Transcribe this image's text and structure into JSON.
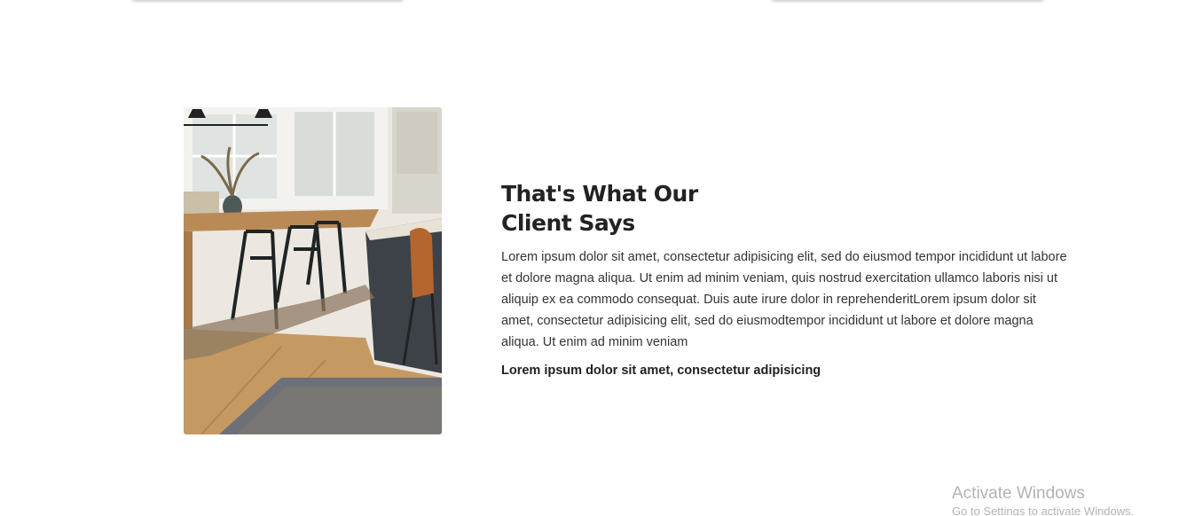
{
  "testimonial": {
    "heading_line1": "That's What Our",
    "heading_line2": "Client Says",
    "body": "Lorem ipsum dolor sit amet, consectetur adipisicing elit, sed do eiusmod tempor incididunt ut labore et dolore magna aliqua. Ut enim ad minim veniam, quis nostrud exercitation ullamco laboris nisi ut aliquip ex ea commodo consequat. Duis aute irure dolor in reprehenderitLorem ipsum dolor sit amet, consectetur adipisicing elit, sed do eiusmodtempor incididunt ut labore et dolore magna aliqua. Ut enim ad minim veniam",
    "author": "Lorem ipsum dolor sit amet, consectetur adipisicing"
  },
  "watermark": {
    "title": "Activate Windows",
    "subtitle": "Go to Settings to activate Windows."
  },
  "colors": {
    "heading": "#222222",
    "body_text": "#333333",
    "watermark": "#b3b3b3"
  }
}
